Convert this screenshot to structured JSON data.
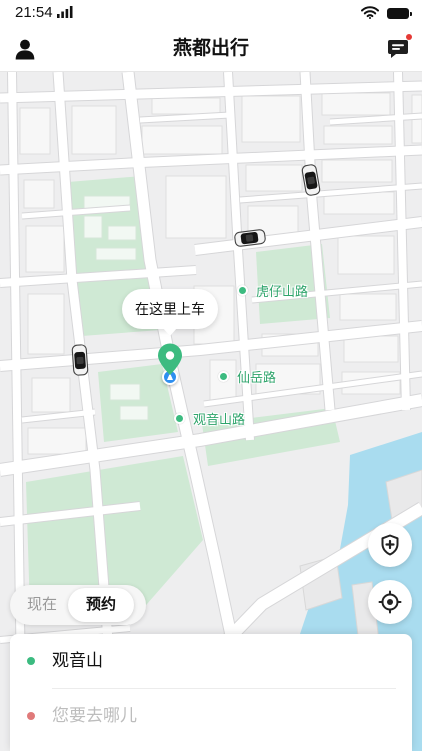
{
  "status_bar": {
    "time": "21:54",
    "icons": [
      "signal-icon",
      "wifi-icon",
      "battery-icon"
    ]
  },
  "header": {
    "title": "燕都出行",
    "left_icon": "user-icon",
    "right_icon": "message-icon",
    "has_unread": true
  },
  "map": {
    "pickup_callout": "在这里上车",
    "road_labels": [
      "虎仔山路",
      "仙岳路",
      "观音山路"
    ],
    "car_icon": "car-icon",
    "pickup_icon": "location-pin-icon"
  },
  "controls": {
    "safety_icon": "shield-plus-icon",
    "locate_icon": "locate-icon"
  },
  "time_toggle": {
    "options": [
      "现在",
      "预约"
    ],
    "selected_index": 1
  },
  "trip": {
    "origin": "观音山",
    "destination_placeholder": "您要去哪儿"
  },
  "colors": {
    "accent": "#3cbb80",
    "destination_dot": "#e07a7a",
    "location_dot": "#2e8ff0",
    "water": "#a9dcef",
    "park": "#cfe9d4"
  }
}
